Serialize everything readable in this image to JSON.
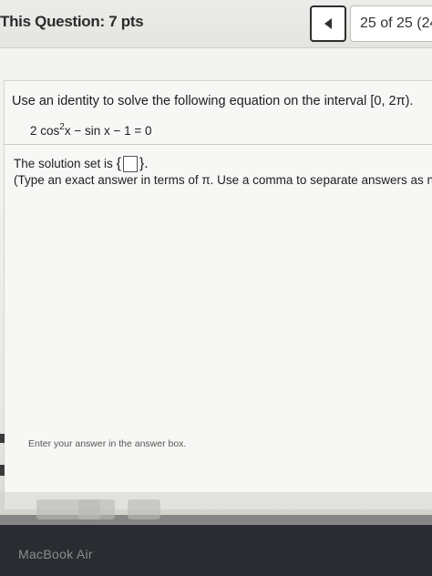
{
  "header": {
    "points": "This Question: 7 pts",
    "pager": "25 of 25 (24"
  },
  "question": {
    "instruction": "Use an identity to solve the following equation on the interval [0, 2π).",
    "equation_lead": "2 cos",
    "equation_exp": "2",
    "equation_tail": "x − sin x − 1 = 0",
    "solution_label": "The solution set is",
    "brace_open": "{",
    "brace_close": "}.",
    "hint": "(Type an exact answer in terms of π. Use a comma to separate answers as need"
  },
  "status": {
    "text": "Enter your answer in the answer box."
  },
  "device": {
    "label": "MacBook Air"
  },
  "icons": {
    "prev": "triangle-left-icon"
  }
}
